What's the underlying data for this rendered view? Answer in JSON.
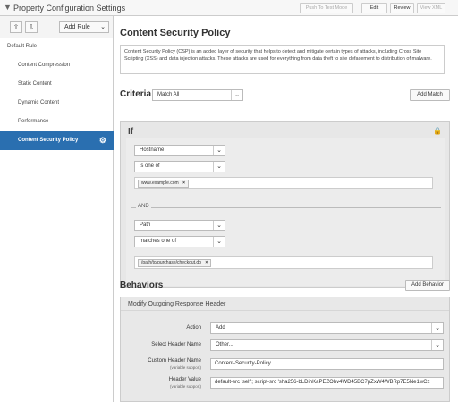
{
  "topbar": {
    "title": "Property Configuration Settings",
    "buttons": [
      "Push To Test Mode",
      "Edit",
      "Review",
      "View XML"
    ]
  },
  "sidebar": {
    "add_rule": "Add Rule",
    "items": [
      {
        "label": "Default Rule"
      },
      {
        "label": "Content Compression"
      },
      {
        "label": "Static Content"
      },
      {
        "label": "Dynamic Content"
      },
      {
        "label": "Performance"
      },
      {
        "label": "Content Security Policy"
      }
    ]
  },
  "main": {
    "title": "Content Security Policy",
    "description": "Content Security Policy (CSP) is an added layer of security that helps to detect and mitigate certain types of attacks, including Cross Site Scripting (XSS) and data injection attacks. These attacks are used for everything from data theft to site defacement to distribution of malware.",
    "criteria_title": "Criteria",
    "match_select": "Match All",
    "add_match": "Add Match",
    "if_label": "If",
    "and_label": "AND",
    "condition1": {
      "field": "Hostname",
      "operator": "is one of",
      "value": "www.example.com"
    },
    "condition2": {
      "field": "Path",
      "operator": "matches one of",
      "value": "/path/to/purchase/checkout.do"
    },
    "behaviors_title": "Behaviors",
    "add_behavior": "Add Behavior",
    "behavior": {
      "header": "Modify Outgoing Response Header",
      "action_label": "Action",
      "action_value": "Add",
      "select_header_label": "Select Header Name",
      "select_header_value": "Other...",
      "custom_header_label": "Custom Header Name",
      "custom_header_sub": "(variable support)",
      "custom_header_value": "Content-Security-Policy",
      "header_value_label": "Header Value",
      "header_value_sub": "(variable support)",
      "header_value_value": "default-src 'self'; script-src 'sha256-bLDihKaPEZOhv4WD45BC7pZxW4WBRp7E5Ne1wCz"
    }
  },
  "icons": {
    "chevron": "chevron-down-icon",
    "up": "double-chevron-up-icon",
    "down": "double-chevron-down-icon",
    "gear": "gear-icon",
    "remove": "close-icon",
    "lock": "lock-icon"
  },
  "colors": {
    "active": "#2a6fb0"
  }
}
